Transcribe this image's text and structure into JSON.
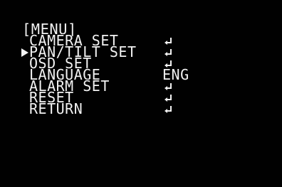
{
  "menu": {
    "title": "[MENU]",
    "items": [
      {
        "label": "CAMERA SET",
        "value": "",
        "icon": "enter-icon",
        "selected": false
      },
      {
        "label": "PAN/TILT SET",
        "value": "",
        "icon": "enter-icon",
        "selected": true
      },
      {
        "label": "OSD SET",
        "value": "",
        "icon": "enter-icon",
        "selected": false
      },
      {
        "label": "LANGUAGE",
        "value": "ENG",
        "icon": "",
        "selected": false
      },
      {
        "label": "ALARM SET",
        "value": "",
        "icon": "enter-icon",
        "selected": false
      },
      {
        "label": "RESET",
        "value": "",
        "icon": "enter-icon",
        "selected": false
      },
      {
        "label": "RETURN",
        "value": "",
        "icon": "enter-icon",
        "selected": false
      }
    ]
  },
  "colors": {
    "background": "#010101",
    "text": "#f2f2f2"
  }
}
